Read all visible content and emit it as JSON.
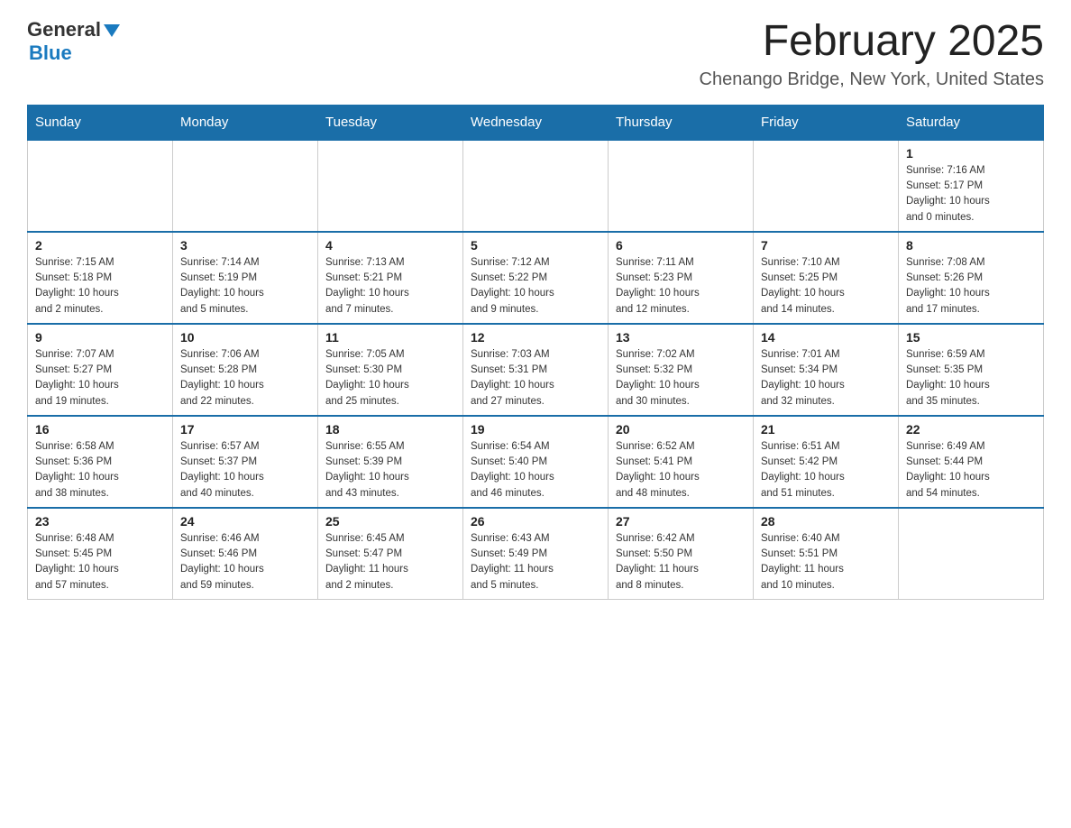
{
  "header": {
    "logo": {
      "general": "General",
      "arrow_symbol": "▶",
      "blue": "Blue"
    },
    "title": "February 2025",
    "subtitle": "Chenango Bridge, New York, United States"
  },
  "calendar": {
    "days_of_week": [
      "Sunday",
      "Monday",
      "Tuesday",
      "Wednesday",
      "Thursday",
      "Friday",
      "Saturday"
    ],
    "weeks": [
      {
        "cells": [
          {
            "day": "",
            "info": ""
          },
          {
            "day": "",
            "info": ""
          },
          {
            "day": "",
            "info": ""
          },
          {
            "day": "",
            "info": ""
          },
          {
            "day": "",
            "info": ""
          },
          {
            "day": "",
            "info": ""
          },
          {
            "day": "1",
            "info": "Sunrise: 7:16 AM\nSunset: 5:17 PM\nDaylight: 10 hours\nand 0 minutes."
          }
        ]
      },
      {
        "cells": [
          {
            "day": "2",
            "info": "Sunrise: 7:15 AM\nSunset: 5:18 PM\nDaylight: 10 hours\nand 2 minutes."
          },
          {
            "day": "3",
            "info": "Sunrise: 7:14 AM\nSunset: 5:19 PM\nDaylight: 10 hours\nand 5 minutes."
          },
          {
            "day": "4",
            "info": "Sunrise: 7:13 AM\nSunset: 5:21 PM\nDaylight: 10 hours\nand 7 minutes."
          },
          {
            "day": "5",
            "info": "Sunrise: 7:12 AM\nSunset: 5:22 PM\nDaylight: 10 hours\nand 9 minutes."
          },
          {
            "day": "6",
            "info": "Sunrise: 7:11 AM\nSunset: 5:23 PM\nDaylight: 10 hours\nand 12 minutes."
          },
          {
            "day": "7",
            "info": "Sunrise: 7:10 AM\nSunset: 5:25 PM\nDaylight: 10 hours\nand 14 minutes."
          },
          {
            "day": "8",
            "info": "Sunrise: 7:08 AM\nSunset: 5:26 PM\nDaylight: 10 hours\nand 17 minutes."
          }
        ]
      },
      {
        "cells": [
          {
            "day": "9",
            "info": "Sunrise: 7:07 AM\nSunset: 5:27 PM\nDaylight: 10 hours\nand 19 minutes."
          },
          {
            "day": "10",
            "info": "Sunrise: 7:06 AM\nSunset: 5:28 PM\nDaylight: 10 hours\nand 22 minutes."
          },
          {
            "day": "11",
            "info": "Sunrise: 7:05 AM\nSunset: 5:30 PM\nDaylight: 10 hours\nand 25 minutes."
          },
          {
            "day": "12",
            "info": "Sunrise: 7:03 AM\nSunset: 5:31 PM\nDaylight: 10 hours\nand 27 minutes."
          },
          {
            "day": "13",
            "info": "Sunrise: 7:02 AM\nSunset: 5:32 PM\nDaylight: 10 hours\nand 30 minutes."
          },
          {
            "day": "14",
            "info": "Sunrise: 7:01 AM\nSunset: 5:34 PM\nDaylight: 10 hours\nand 32 minutes."
          },
          {
            "day": "15",
            "info": "Sunrise: 6:59 AM\nSunset: 5:35 PM\nDaylight: 10 hours\nand 35 minutes."
          }
        ]
      },
      {
        "cells": [
          {
            "day": "16",
            "info": "Sunrise: 6:58 AM\nSunset: 5:36 PM\nDaylight: 10 hours\nand 38 minutes."
          },
          {
            "day": "17",
            "info": "Sunrise: 6:57 AM\nSunset: 5:37 PM\nDaylight: 10 hours\nand 40 minutes."
          },
          {
            "day": "18",
            "info": "Sunrise: 6:55 AM\nSunset: 5:39 PM\nDaylight: 10 hours\nand 43 minutes."
          },
          {
            "day": "19",
            "info": "Sunrise: 6:54 AM\nSunset: 5:40 PM\nDaylight: 10 hours\nand 46 minutes."
          },
          {
            "day": "20",
            "info": "Sunrise: 6:52 AM\nSunset: 5:41 PM\nDaylight: 10 hours\nand 48 minutes."
          },
          {
            "day": "21",
            "info": "Sunrise: 6:51 AM\nSunset: 5:42 PM\nDaylight: 10 hours\nand 51 minutes."
          },
          {
            "day": "22",
            "info": "Sunrise: 6:49 AM\nSunset: 5:44 PM\nDaylight: 10 hours\nand 54 minutes."
          }
        ]
      },
      {
        "cells": [
          {
            "day": "23",
            "info": "Sunrise: 6:48 AM\nSunset: 5:45 PM\nDaylight: 10 hours\nand 57 minutes."
          },
          {
            "day": "24",
            "info": "Sunrise: 6:46 AM\nSunset: 5:46 PM\nDaylight: 10 hours\nand 59 minutes."
          },
          {
            "day": "25",
            "info": "Sunrise: 6:45 AM\nSunset: 5:47 PM\nDaylight: 11 hours\nand 2 minutes."
          },
          {
            "day": "26",
            "info": "Sunrise: 6:43 AM\nSunset: 5:49 PM\nDaylight: 11 hours\nand 5 minutes."
          },
          {
            "day": "27",
            "info": "Sunrise: 6:42 AM\nSunset: 5:50 PM\nDaylight: 11 hours\nand 8 minutes."
          },
          {
            "day": "28",
            "info": "Sunrise: 6:40 AM\nSunset: 5:51 PM\nDaylight: 11 hours\nand 10 minutes."
          },
          {
            "day": "",
            "info": ""
          }
        ]
      }
    ]
  }
}
